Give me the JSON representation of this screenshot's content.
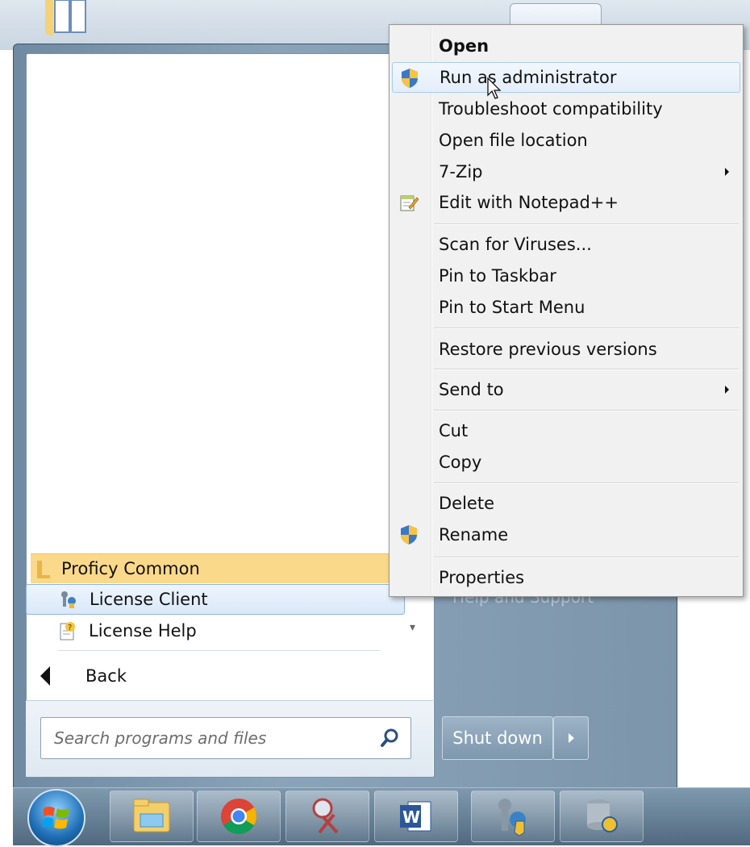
{
  "start_menu": {
    "folder": {
      "label": "Proficy Common",
      "icon": "folder-icon"
    },
    "programs": [
      {
        "label": "License Client",
        "icon": "license-client-icon",
        "selected": true
      },
      {
        "label": "License Help",
        "icon": "help-file-icon",
        "selected": false
      }
    ],
    "back_label": "Back",
    "search_placeholder": "Search programs and files",
    "right_pane_partial_text": "Help and Support",
    "shutdown_label": "Shut down"
  },
  "context_menu": {
    "items": [
      {
        "label": "Open",
        "bold": true
      },
      {
        "label": "Run as administrator",
        "icon": "uac-shield-icon",
        "highlighted": true
      },
      {
        "label": "Troubleshoot compatibility"
      },
      {
        "label": "Open file location"
      },
      {
        "label": "7-Zip",
        "submenu": true
      },
      {
        "label": "Edit with Notepad++",
        "icon": "notepadpp-icon"
      },
      {
        "label": "Scan for Viruses..."
      },
      {
        "label": "Pin to Taskbar"
      },
      {
        "label": "Pin to Start Menu"
      },
      {
        "label": "Restore previous versions"
      },
      {
        "label": "Send to",
        "submenu": true
      },
      {
        "label": "Cut"
      },
      {
        "label": "Copy"
      },
      {
        "label": "Delete"
      },
      {
        "label": "Rename",
        "icon": "uac-shield-icon"
      },
      {
        "label": "Properties"
      }
    ]
  },
  "taskbar": {
    "buttons": [
      "windows-explorer-icon",
      "chrome-icon",
      "snipping-tool-icon",
      "word-icon",
      "license-client-icon",
      "database-config-icon"
    ]
  },
  "colors": {
    "folder_highlight": "#fbd98a",
    "menu_highlight": "#e3eefa",
    "start_frame": "#7c95ab"
  }
}
